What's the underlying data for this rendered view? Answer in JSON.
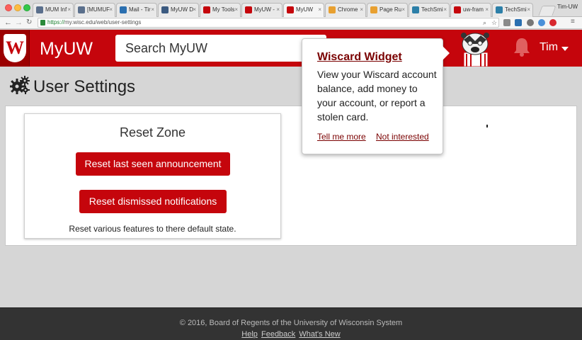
{
  "browser": {
    "tabs": [
      {
        "label": "MUM Inf",
        "color": "#5a6f8c"
      },
      {
        "label": "[MUMUF",
        "color": "#5a6f8c"
      },
      {
        "label": "Mail - Tir",
        "color": "#2a6fb0"
      },
      {
        "label": "MyUW D",
        "color": "#3b5a80"
      },
      {
        "label": "My Tools",
        "color": "#c5050c"
      },
      {
        "label": "MyUW -",
        "color": "#c5050c"
      },
      {
        "label": "MyUW",
        "color": "#c5050c"
      },
      {
        "label": "Chrome",
        "color": "#e8a030"
      },
      {
        "label": "Page Ru",
        "color": "#e8a030"
      },
      {
        "label": "TechSmi",
        "color": "#2c7fa8"
      },
      {
        "label": "uw-fram",
        "color": "#c5050c"
      },
      {
        "label": "TechSmi",
        "color": "#2c7fa8"
      }
    ],
    "profile": "Tim-UW",
    "url_scheme": "https://",
    "url_rest": "my.wisc.edu/web/user-settings"
  },
  "header": {
    "brand": "MyUW",
    "search_placeholder": "Search MyUW",
    "user": "Tim",
    "accent": "#c5050c"
  },
  "page": {
    "title": "User Settings"
  },
  "reset_card": {
    "title": "Reset Zone",
    "button_announcement": "Reset last seen announcement",
    "button_notifications": "Reset dismissed notifications",
    "description": "Reset various features to there default state."
  },
  "popover": {
    "title": "Wiscard Widget",
    "body": "View your Wiscard account balance, add money to your account, or report a stolen card.",
    "link_more": "Tell me more",
    "link_dismiss": "Not interested"
  },
  "footer": {
    "copyright": "© 2016, Board of Regents of the University of Wisconsin System",
    "links": [
      "Help",
      "Feedback",
      "What's New"
    ]
  }
}
